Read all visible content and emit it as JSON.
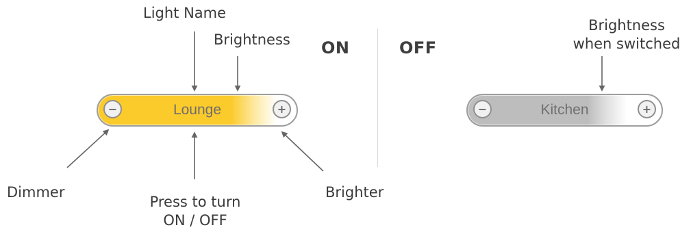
{
  "headings": {
    "on": "ON",
    "off": "OFF"
  },
  "labels": {
    "light_name": "Light Name",
    "brightness": "Brightness",
    "brightness_switched_line1": "Brightness",
    "brightness_switched_line2": "when switched",
    "dimmer": "Dimmer",
    "press_line1": "Press to turn",
    "press_line2": "ON / OFF",
    "brighter": "Brighter"
  },
  "controls": {
    "on_light": {
      "name": "Lounge",
      "minus": "−",
      "plus": "+",
      "state": "on",
      "color": "#fbca2b"
    },
    "off_light": {
      "name": "Kitchen",
      "minus": "−",
      "plus": "+",
      "state": "off",
      "color": "#bdbdbd"
    }
  },
  "colors": {
    "arrow": "#666666",
    "on_fill": "#fbca2b",
    "off_fill": "#bdbdbd",
    "border": "#9e9e9e"
  }
}
